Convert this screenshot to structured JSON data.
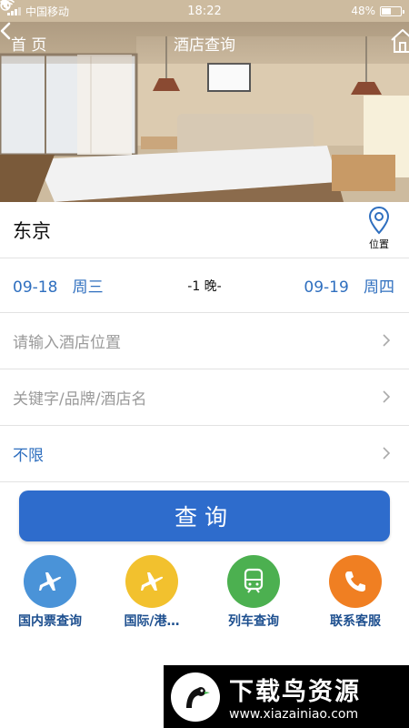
{
  "status_bar": {
    "carrier": "中国移动",
    "time": "18:22",
    "battery": "48%",
    "battery_level": 0.48
  },
  "nav": {
    "back_label": "首 页",
    "title": "酒店查询",
    "home_icon": "home-icon"
  },
  "search": {
    "city": "东京",
    "location_label": "位置",
    "check_in_date": "09-18",
    "check_in_weekday": "周三",
    "nights": "-1 晚-",
    "check_out_date": "09-19",
    "check_out_weekday": "周四",
    "hotel_location_placeholder": "请输入酒店位置",
    "keyword_placeholder": "关键字/品牌/酒店名",
    "price_value": "不限",
    "query_button": "查询"
  },
  "quick_links": [
    {
      "label": "国内票查询",
      "icon": "plane-icon",
      "color": "#4a93d8"
    },
    {
      "label": "国际/港…",
      "icon": "plane-icon",
      "color": "#f2c12e"
    },
    {
      "label": "列车查询",
      "icon": "train-icon",
      "color": "#4cb050"
    },
    {
      "label": "联系客服",
      "icon": "phone-icon",
      "color": "#f07f22"
    }
  ],
  "colors": {
    "accent_blue": "#2e6ccc",
    "link_blue": "#2f6fbf"
  },
  "watermark": {
    "title": "下载鸟资源",
    "url": "www.xiazainiao.com"
  }
}
